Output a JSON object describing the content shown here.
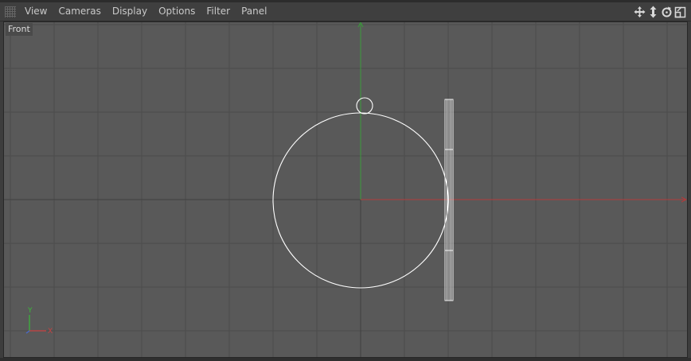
{
  "menu": {
    "items": [
      {
        "label": "View"
      },
      {
        "label": "Cameras"
      },
      {
        "label": "Display"
      },
      {
        "label": "Options"
      },
      {
        "label": "Filter"
      },
      {
        "label": "Panel"
      }
    ]
  },
  "toolbar_icons": [
    "move-view-icon",
    "dolly-view-icon",
    "rotate-view-icon",
    "toggle-layout-icon"
  ],
  "viewport": {
    "label": "Front",
    "axis_indicator": {
      "y": "Y",
      "x": "X"
    }
  },
  "colors": {
    "viewport_bg": "#595959",
    "grid": "#4c4c4c",
    "grid_major": "#3f3f3f",
    "axis_x": "#b43a3a",
    "axis_y": "#3a9a3a",
    "wire": "#ffffff"
  }
}
